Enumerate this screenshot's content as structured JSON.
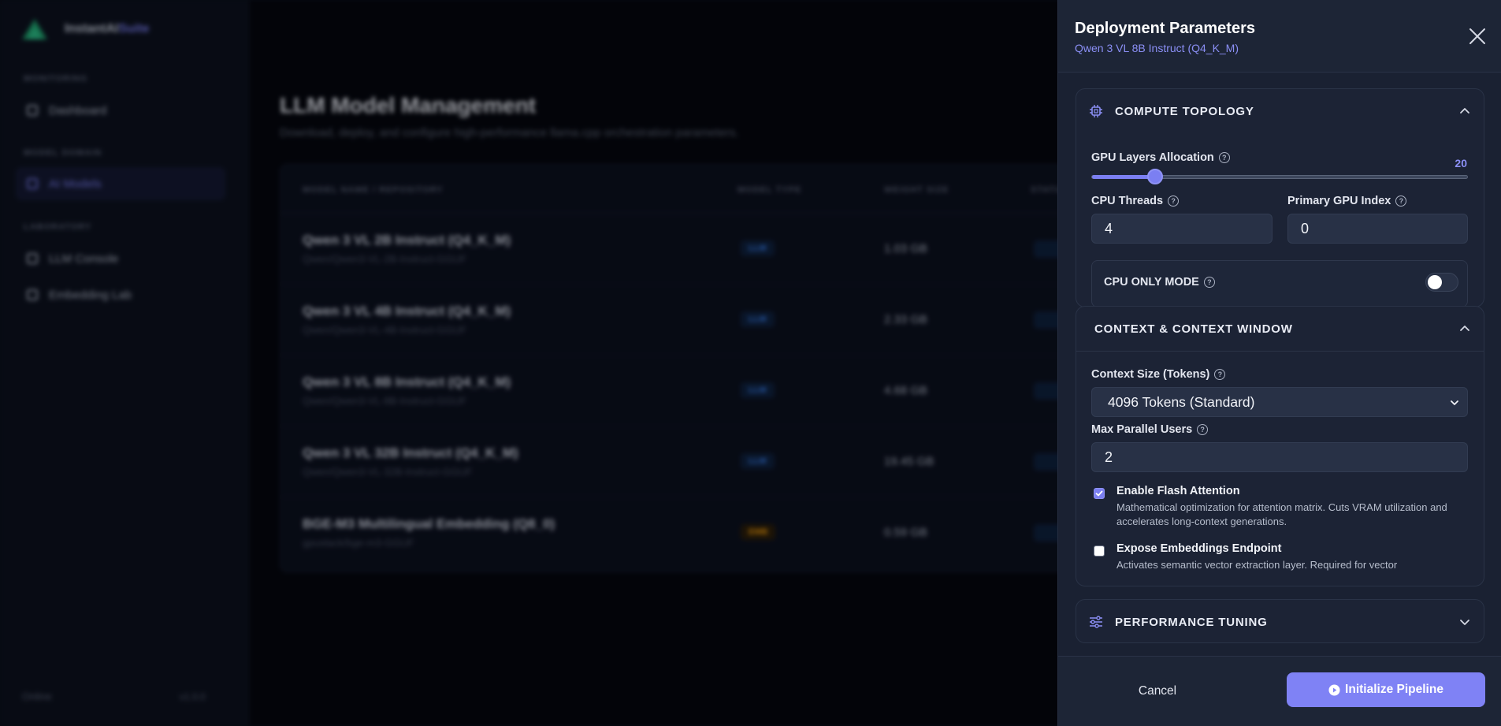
{
  "background": {
    "brand_name": "InstantAI",
    "brand_accent": "Suite",
    "sections": [
      "MONITORING",
      "MODEL DOMAIN",
      "LABORATORY"
    ],
    "nav": [
      {
        "label": "Dashboard",
        "icon": "home-icon",
        "active": false
      },
      {
        "label": "AI Models",
        "icon": "cube-icon",
        "active": true
      },
      {
        "label": "LLM Console",
        "icon": "terminal-icon",
        "active": false
      },
      {
        "label": "Embedding Lab",
        "icon": "flask-icon",
        "active": false
      }
    ],
    "footer_status": "Online",
    "footer_version": "v1.0.0",
    "page_title": "LLM Model Management",
    "page_subtitle": "Download, deploy, and configure high-performance llama.cpp orchestration parameters.",
    "table_headers": [
      "MODEL NAME / REPOSITORY",
      "MODEL TYPE",
      "WEIGHT SIZE",
      "STATUS"
    ],
    "rows": [
      {
        "name": "Qwen 3 VL 2B Instruct (Q4_K_M)",
        "repo": "Qwen/Qwen3-VL-2B-Instruct-GGUF",
        "type": "LLM",
        "size": "1.03 GB"
      },
      {
        "name": "Qwen 3 VL 4B Instruct (Q4_K_M)",
        "repo": "Qwen/Qwen3-VL-4B-Instruct-GGUF",
        "type": "LLM",
        "size": "2.33 GB"
      },
      {
        "name": "Qwen 3 VL 8B Instruct (Q4_K_M)",
        "repo": "Qwen/Qwen3-VL-8B-Instruct-GGUF",
        "type": "LLM",
        "size": "4.68 GB"
      },
      {
        "name": "Qwen 3 VL 32B Instruct (Q4_K_M)",
        "repo": "Qwen/Qwen3-VL-32B-Instruct-GGUF",
        "type": "LLM",
        "size": "19.45 GB"
      },
      {
        "name": "BGE-M3 Multilingual Embedding (Q8_0)",
        "repo": "gpustack/bge-m3-GGUF",
        "type": "EMB",
        "size": "0.59 GB"
      }
    ]
  },
  "panel": {
    "title": "Deployment Parameters",
    "subtitle": "Qwen 3 VL 8B Instruct (Q4_K_M)",
    "compute": {
      "title": "COMPUTE TOPOLOGY",
      "gpu_layers_label": "GPU Layers Allocation",
      "gpu_layers_value": "20",
      "gpu_layers_fraction": 0.17,
      "cpu_threads_label": "CPU Threads",
      "cpu_threads_value": "4",
      "gpu_index_label": "Primary GPU Index",
      "gpu_index_value": "0",
      "cpu_only_label": "CPU ONLY MODE",
      "cpu_only_enabled": false
    },
    "context": {
      "title": "CONTEXT & CONTEXT WINDOW",
      "context_size_label": "Context Size (Tokens)",
      "context_size_value": "4096 Tokens (Standard)",
      "parallel_label": "Max Parallel Users",
      "parallel_value": "2",
      "flash_title": "Enable Flash Attention",
      "flash_desc": "Mathematical optimization for attention matrix. Cuts VRAM utilization and accelerates long-context generations.",
      "flash_enabled": true,
      "embed_title": "Expose Embeddings Endpoint",
      "embed_desc": "Activates semantic vector extraction layer. Required for vector",
      "embed_enabled": false
    },
    "performance": {
      "title": "PERFORMANCE TUNING"
    },
    "footer": {
      "cancel_label": "Cancel",
      "init_label": "Initialize Pipeline"
    }
  },
  "colors": {
    "accent": "#7b7ff2",
    "panel_bg": "#1a2132",
    "llm_badge": "#3b82f6",
    "emb_badge": "#f59e0b"
  }
}
